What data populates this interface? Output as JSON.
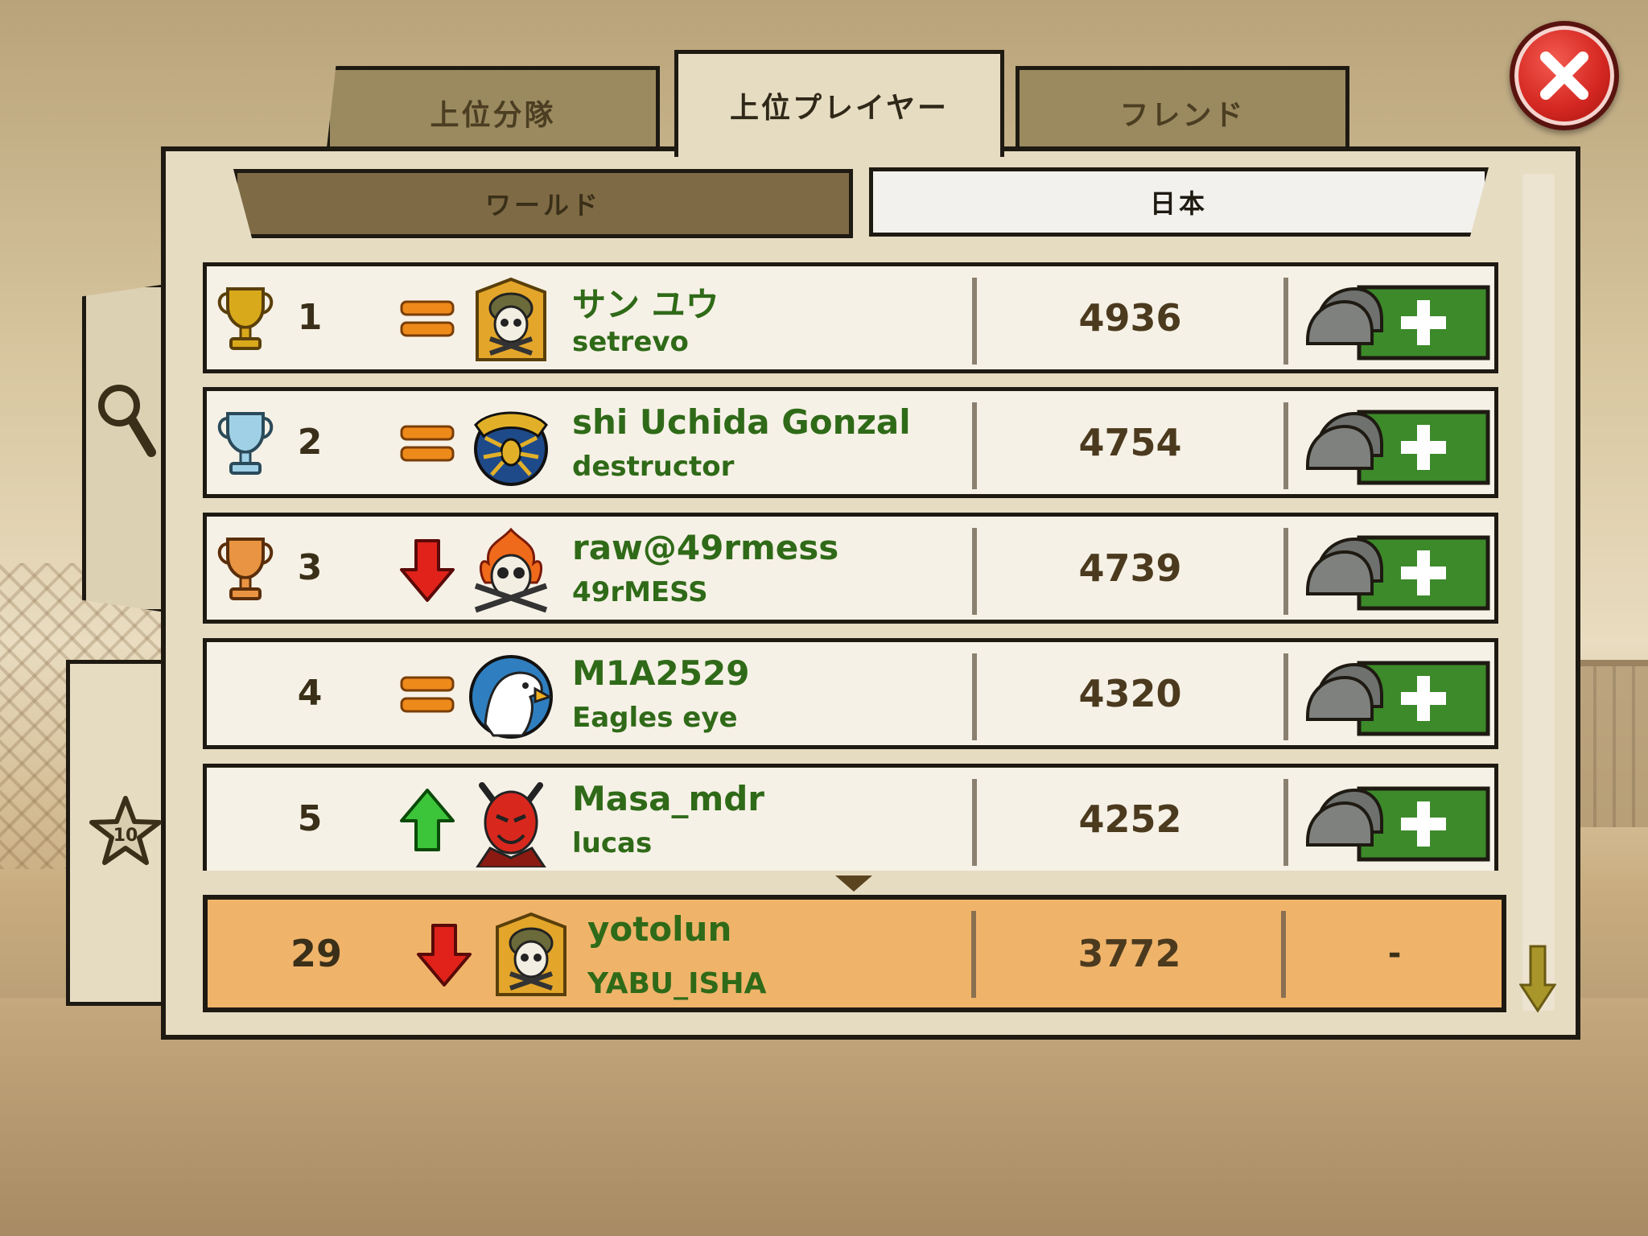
{
  "tabs": {
    "squads": "上位分隊",
    "players": "上位プレイヤー",
    "friends": "フレンド"
  },
  "region": {
    "world": "ワールド",
    "japan": "日本"
  },
  "side": {
    "level": "10"
  },
  "rows": [
    {
      "rank": "1",
      "trophy": "gold-trophy",
      "trend": "same",
      "avatar": "skull-helmet",
      "name": "サン ユウ",
      "sub": "setrevo",
      "score": "4936"
    },
    {
      "rank": "2",
      "trophy": "silver-trophy",
      "trend": "same",
      "avatar": "spider-emblem",
      "name": "shi Uchida Gonzal",
      "sub": "destructor",
      "score": "4754"
    },
    {
      "rank": "3",
      "trophy": "bronze-trophy",
      "trend": "down",
      "avatar": "flaming-skull",
      "name": "raw@49rmess",
      "sub": "49rMESS",
      "score": "4739"
    },
    {
      "rank": "4",
      "trophy": "",
      "trend": "same",
      "avatar": "eagle",
      "name": "M1A2529",
      "sub": "Eagles eye",
      "score": "4320"
    },
    {
      "rank": "5",
      "trophy": "",
      "trend": "up",
      "avatar": "devil",
      "name": "Masa_mdr",
      "sub": "lucas",
      "score": "4252"
    }
  ],
  "me": {
    "rank": "29",
    "trend": "down",
    "avatar": "skull-helmet",
    "name": "yotolun",
    "sub": "YABU_ISHA",
    "score": "3772",
    "friend": "-"
  },
  "colors": {
    "name_green": "#2f6a18",
    "panel": "#e6dcc2",
    "my_row": "#efb46a",
    "add_green": "#3c8a2a"
  }
}
